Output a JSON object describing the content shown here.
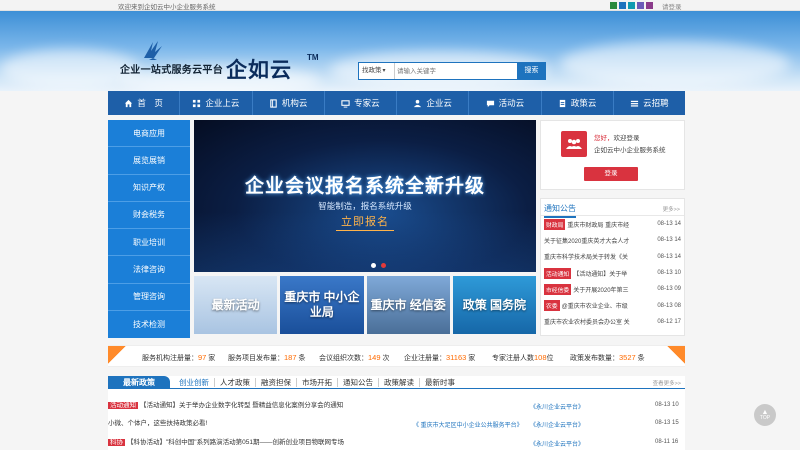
{
  "topbar": {
    "welcome": "欢迎来到企如云中小企业服务系统",
    "login_label": "请登录",
    "theme_colors": [
      "#2a8a3e",
      "#1e73be",
      "#0e9ab0",
      "#6a5ab8",
      "#8a3a8a"
    ]
  },
  "header": {
    "logo_tagline": "企业一站式服务云平台",
    "logo_name": "企如云",
    "logo_tm": "TM",
    "search_category": "找政策",
    "search_placeholder": "请输入关键字",
    "search_button": "搜索"
  },
  "nav": {
    "items": [
      {
        "label": "首　页",
        "icon": "home-icon"
      },
      {
        "label": "企业上云",
        "icon": "grid-icon"
      },
      {
        "label": "机构云",
        "icon": "book-icon"
      },
      {
        "label": "专家云",
        "icon": "monitor-icon"
      },
      {
        "label": "企业云",
        "icon": "user-icon"
      },
      {
        "label": "活动云",
        "icon": "chat-icon"
      },
      {
        "label": "政策云",
        "icon": "document-icon"
      },
      {
        "label": "云招聘",
        "icon": "list-icon"
      }
    ]
  },
  "sidemenu": {
    "items": [
      "电商应用",
      "展览展销",
      "知识产权",
      "财会税务",
      "职业培训",
      "法律咨询",
      "管理咨询",
      "技术检测"
    ]
  },
  "carousel": {
    "title": "企业会议报名系统全新升级",
    "subtitle": "智能制造，报名系统升级",
    "cta": "立即报名",
    "active_slide": 2,
    "slide_count": 2
  },
  "thumbs": [
    "最新活动",
    "重庆市 中小企业局",
    "重庆市 经信委",
    "政策 国务院"
  ],
  "login_box": {
    "greeting": "您好，",
    "welcome": "欢迎登录",
    "system": "企如云中小企业服务系统",
    "button": "登录"
  },
  "notice": {
    "title": "通知公告",
    "more": "更多>>",
    "rows": [
      {
        "tag": "财政局",
        "text": "重庆市财政局  重庆市经",
        "date": "08-13 14"
      },
      {
        "tag": "",
        "text": "关于征集2020重庆英才大会人才",
        "date": "08-13 14"
      },
      {
        "tag": "",
        "text": "重庆市科学技术局关于转发《关",
        "date": "08-13 14"
      },
      {
        "tag": "活动通知",
        "text": "【活动通知】关于举",
        "date": "08-13 10"
      },
      {
        "tag": "市经信委",
        "text": "关于开展2020年第三",
        "date": "08-13 09"
      },
      {
        "tag": "农委",
        "text": "@重庆市农业企业、市级",
        "date": "08-13 08"
      },
      {
        "tag": "",
        "text": "重庆市农业农村委员会办公室 关",
        "date": "08-12 17"
      }
    ]
  },
  "stats": [
    {
      "label": "服务机构注册量：",
      "value": "97",
      "unit": "家"
    },
    {
      "label": "服务项目发布量：",
      "value": "187",
      "unit": "条"
    },
    {
      "label": "会议组织次数：",
      "value": "149",
      "unit": "次"
    },
    {
      "label": "企业注册量：",
      "value": "31163",
      "unit": "家"
    },
    {
      "label": "专家注册人数",
      "value": "108",
      "unit": "位"
    },
    {
      "label": "政策发布数量：",
      "value": "3527",
      "unit": "条"
    }
  ],
  "policy": {
    "label": "最新政策",
    "tabs": [
      "创业创新",
      "人才政策",
      "融资担保",
      "市场开拓",
      "通知公告",
      "政策解读",
      "最新时事"
    ],
    "more": "查看更多>>",
    "rows": [
      {
        "tag": "活动通知",
        "text": "【活动通知】关于举办企业数字化转型 暨精益信息化案例分享会的通知",
        "source": "",
        "platform": "《永川企业云平台》",
        "date": "08-13 10"
      },
      {
        "tag": "",
        "text": "小微、个体户，这些扶持政策必看!",
        "source": "《 重庆市大足区中小企业公共服务平台》",
        "platform": "《永川企业云平台》",
        "date": "08-13 15"
      },
      {
        "tag": "科协",
        "text": "【科协活动】\"科创中国\"系列路演活动第051期——创新创业项目物联网专场",
        "source": "",
        "platform": "《永川企业云平台》",
        "date": "08-11 16"
      }
    ]
  },
  "totop": "TOP"
}
